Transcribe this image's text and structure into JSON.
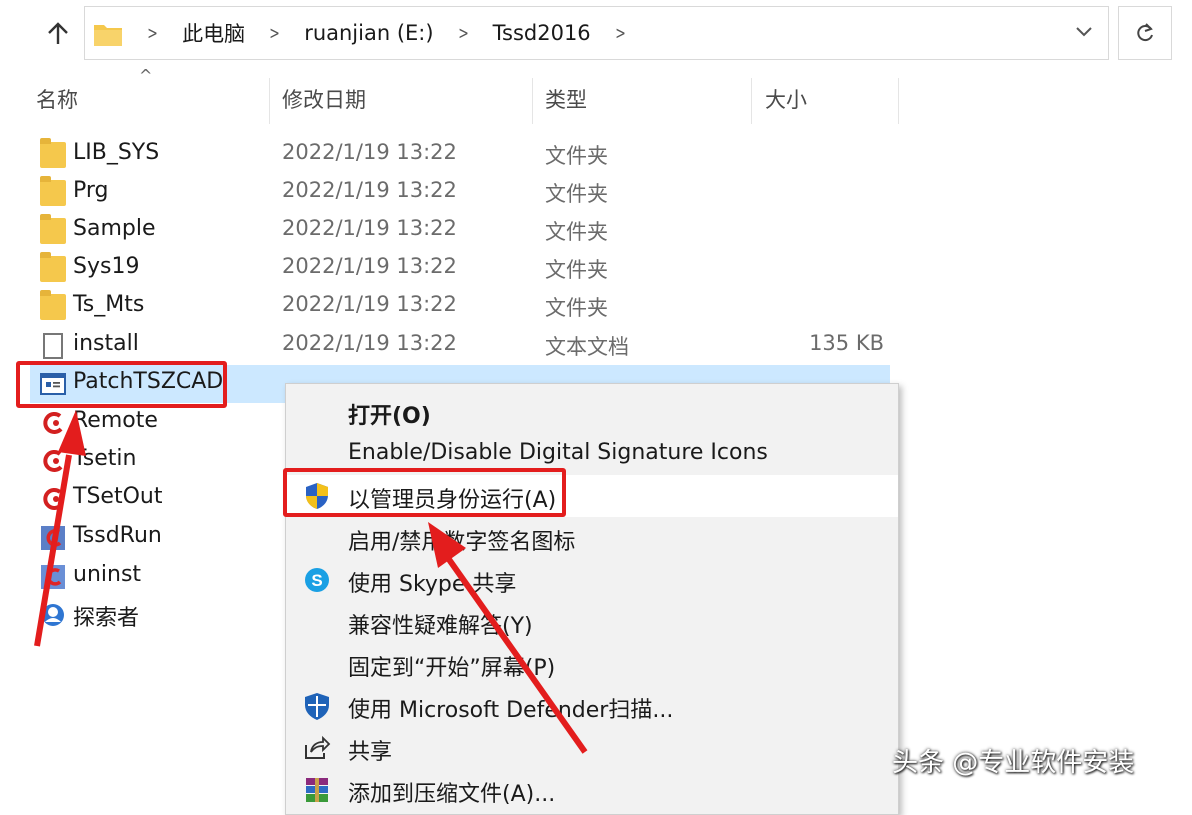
{
  "address_bar": {
    "crumbs": [
      "此电脑",
      "ruanjian (E:)",
      "Tssd2016"
    ]
  },
  "columns": {
    "name": "名称",
    "modified": "修改日期",
    "type": "类型",
    "size": "大小"
  },
  "files": [
    {
      "name": "LIB_SYS",
      "date": "2022/1/19 13:22",
      "type": "文件夹",
      "size": "",
      "icon": "folder-icon"
    },
    {
      "name": "Prg",
      "date": "2022/1/19 13:22",
      "type": "文件夹",
      "size": "",
      "icon": "folder-icon"
    },
    {
      "name": "Sample",
      "date": "2022/1/19 13:22",
      "type": "文件夹",
      "size": "",
      "icon": "folder-icon"
    },
    {
      "name": "Sys19",
      "date": "2022/1/19 13:22",
      "type": "文件夹",
      "size": "",
      "icon": "folder-icon"
    },
    {
      "name": "Ts_Mts",
      "date": "2022/1/19 13:22",
      "type": "文件夹",
      "size": "",
      "icon": "folder-icon"
    },
    {
      "name": "install",
      "date": "2022/1/19 13:22",
      "type": "文本文档",
      "size": "135 KB",
      "icon": "text-file-icon"
    },
    {
      "name": "PatchTSZCAD",
      "date": "",
      "type": "",
      "size": "",
      "icon": "application-icon"
    },
    {
      "name": "Remote",
      "icon": "tssd-app-icon"
    },
    {
      "name": "Tsetin",
      "icon": "tssd-app-icon"
    },
    {
      "name": "TSetOut",
      "icon": "tssd-app-icon"
    },
    {
      "name": "TssdRun",
      "icon": "tssd-run-icon"
    },
    {
      "name": "uninst",
      "icon": "uninstall-icon"
    },
    {
      "name": "探索者",
      "icon": "explorer-app-icon"
    }
  ],
  "context_menu": {
    "items": [
      {
        "label": "打开(O)",
        "icon": ""
      },
      {
        "label": "Enable/Disable Digital Signature Icons",
        "icon": ""
      },
      {
        "label": "以管理员身份运行(A)",
        "icon": "uac-shield-icon"
      },
      {
        "label": "启用/禁用数字签名图标",
        "icon": ""
      },
      {
        "label": "使用 Skype 共享",
        "icon": "skype-icon"
      },
      {
        "label": "兼容性疑难解答(Y)",
        "icon": ""
      },
      {
        "label": "固定到“开始”屏幕(P)",
        "icon": ""
      },
      {
        "label": "使用 Microsoft Defender扫描...",
        "icon": "defender-icon"
      },
      {
        "label": "共享",
        "icon": "share-icon"
      },
      {
        "label": "添加到压缩文件(A)...",
        "icon": "winrar-icon"
      }
    ]
  },
  "watermark": "头条 @专业软件安装",
  "colors": {
    "selection": "#cce8ff",
    "highlight_red": "#e31d1d",
    "folder_yellow": "#f5c84c",
    "menu_bg": "#f2f2f2"
  }
}
